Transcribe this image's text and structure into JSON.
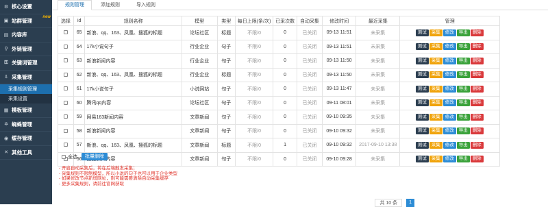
{
  "sidebar": {
    "items": [
      {
        "label": "核心设置",
        "icon": "gear-icon",
        "glyph": "⚙"
      },
      {
        "label": "站群管理",
        "icon": "sitemap-icon",
        "glyph": "▣",
        "badge": "new"
      },
      {
        "label": "内容库",
        "icon": "file-icon",
        "glyph": "▤"
      },
      {
        "label": "外链管理",
        "icon": "link-icon",
        "glyph": "⚲"
      },
      {
        "label": "关键词管理",
        "icon": "key-icon",
        "glyph": "⚿"
      },
      {
        "label": "采集管理",
        "icon": "download-icon",
        "glyph": "⇩"
      }
    ],
    "subitems": [
      {
        "label": "采集规则管理",
        "active": true
      },
      {
        "label": "采集设置",
        "active": false
      }
    ],
    "items2": [
      {
        "label": "模板管理",
        "icon": "template-icon",
        "glyph": "▦"
      },
      {
        "label": "蜘蛛管理",
        "icon": "spider-icon",
        "glyph": "✲"
      },
      {
        "label": "缓存管理",
        "icon": "cache-icon",
        "glyph": "◉"
      },
      {
        "label": "其他工具",
        "icon": "tools-icon",
        "glyph": "✕"
      }
    ]
  },
  "tabs": [
    "规则管理",
    "添加规则",
    "导入规则"
  ],
  "table": {
    "headers": [
      "选择",
      "id",
      "规则名称",
      "模型",
      "类型",
      "每日上限(条/次)",
      "已采次数",
      "自动采集",
      "修改时间",
      "最近采集",
      "管理"
    ],
    "rows": [
      {
        "id": "65",
        "name": "新浪、qq、163、凤凰、搜狐的标题",
        "model": "论坛社区",
        "type": "标题",
        "limit": "不限/0",
        "count": "0",
        "auto": "已关闭",
        "mtime": "09-13 11:51",
        "last": "未采集"
      },
      {
        "id": "64",
        "name": "17k小说句子",
        "model": "行业企业",
        "type": "句子",
        "limit": "不限/0",
        "count": "0",
        "auto": "已关闭",
        "mtime": "09-13 11:51",
        "last": "未采集"
      },
      {
        "id": "63",
        "name": "新浪新闻内容",
        "model": "行业企业",
        "type": "句子",
        "limit": "不限/0",
        "count": "0",
        "auto": "已关闭",
        "mtime": "09-13 11:50",
        "last": "未采集"
      },
      {
        "id": "62",
        "name": "新浪、qq、163、凤凰、搜狐的标题",
        "model": "行业企业",
        "type": "标题",
        "limit": "不限/0",
        "count": "0",
        "auto": "已关闭",
        "mtime": "09-13 11:50",
        "last": "未采集"
      },
      {
        "id": "61",
        "name": "17k小说句子",
        "model": "小说网站",
        "type": "句子",
        "limit": "不限/0",
        "count": "0",
        "auto": "已关闭",
        "mtime": "09-13 11:47",
        "last": "未采集"
      },
      {
        "id": "60",
        "name": "腾讯qq内容",
        "model": "论坛社区",
        "type": "句子",
        "limit": "不限/0",
        "count": "0",
        "auto": "已关闭",
        "mtime": "09-11 08:01",
        "last": "未采集"
      },
      {
        "id": "59",
        "name": "网易163新闻内容",
        "model": "文章新闻",
        "type": "句子",
        "limit": "不限/0",
        "count": "0",
        "auto": "已关闭",
        "mtime": "09-10 09:35",
        "last": "未采集"
      },
      {
        "id": "58",
        "name": "新浪新闻内容",
        "model": "文章新闻",
        "type": "句子",
        "limit": "不限/0",
        "count": "0",
        "auto": "已关闭",
        "mtime": "09-10 09:32",
        "last": "未采集"
      },
      {
        "id": "57",
        "name": "新浪、qq、163、凤凰、搜狐的标题",
        "model": "文章新闻",
        "type": "标题",
        "limit": "不限/0",
        "count": "1",
        "auto": "已关闭",
        "mtime": "09-10 09:32",
        "last": "2017-09-10 13:38"
      },
      {
        "id": "56",
        "name": "搜狐新闻内容",
        "model": "文章新闻",
        "type": "句子",
        "limit": "不限/0",
        "count": "0",
        "auto": "已关闭",
        "mtime": "09-10 09:28",
        "last": "未采集"
      }
    ],
    "actions": [
      {
        "label": "测试",
        "cls": "b-test",
        "name": "test-button"
      },
      {
        "label": "采集",
        "cls": "b-cj",
        "name": "collect-button"
      },
      {
        "label": "修改",
        "cls": "b-edit",
        "name": "edit-button"
      },
      {
        "label": "导出",
        "cls": "b-exp",
        "name": "export-button"
      },
      {
        "label": "删除",
        "cls": "b-del",
        "name": "delete-button"
      }
    ]
  },
  "footer": {
    "select_all": "全选",
    "batch_delete": "批量删除",
    "notes": [
      "- 开启自动采集后，将在后端触发采集；",
      "- 采集规则不限制模型，所以小说的句子也可以用于企业类型",
      "- 如果修改节点新增网址，则可能需要清除自动采集缓存",
      "- 更多采集规则，请前往官网获取"
    ],
    "pager_total": "共 10 条",
    "pager_current": "1"
  }
}
